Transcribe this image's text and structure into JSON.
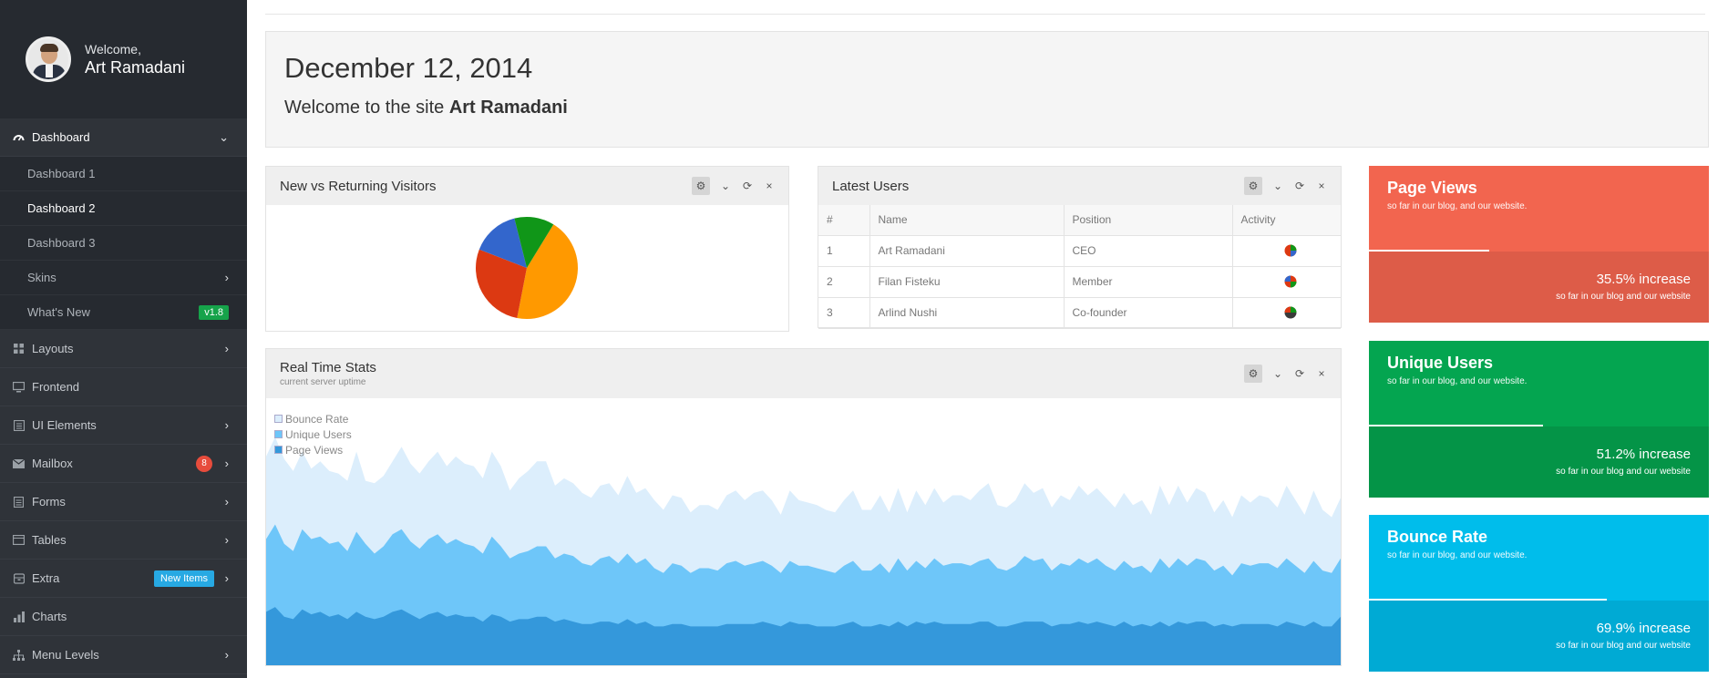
{
  "profile": {
    "welcome": "Welcome,",
    "name": "Art Ramadani"
  },
  "nav": {
    "dashboard": "Dashboard",
    "sub": [
      "Dashboard 1",
      "Dashboard 2",
      "Dashboard 3",
      "Skins",
      "What's New"
    ],
    "whats_new_badge": "v1.8",
    "layouts": "Layouts",
    "frontend": "Frontend",
    "ui_elements": "UI Elements",
    "mailbox": "Mailbox",
    "mailbox_count": "8",
    "forms": "Forms",
    "tables": "Tables",
    "extra": "Extra",
    "extra_badge": "New Items",
    "charts": "Charts",
    "menu_levels": "Menu Levels"
  },
  "hero": {
    "date": "December 12, 2014",
    "welcome_prefix": "Welcome to the site ",
    "welcome_name": "Art Ramadani"
  },
  "visitors": {
    "title": "New vs Returning Visitors",
    "chart_data": {
      "type": "pie",
      "values": [
        35,
        22,
        12,
        10
      ],
      "colors": [
        "#ff9900",
        "#dc3912",
        "#3366cc",
        "#109618"
      ]
    }
  },
  "latest_users": {
    "title": "Latest Users",
    "headers": [
      "#",
      "Name",
      "Position",
      "Activity"
    ],
    "rows": [
      {
        "num": "1",
        "name": "Art Ramadani",
        "position": "CEO"
      },
      {
        "num": "2",
        "name": "Filan Fisteku",
        "position": "Member"
      },
      {
        "num": "3",
        "name": "Arlind Nushi",
        "position": "Co-founder"
      }
    ]
  },
  "realtime": {
    "title": "Real Time Stats",
    "subtitle": "current server uptime",
    "chart_data": {
      "type": "area",
      "series": [
        {
          "name": "Bounce Rate",
          "color": "#dceefc",
          "values": [
            86,
            94,
            85,
            80,
            88,
            81,
            84,
            80,
            79,
            76,
            88,
            76,
            75,
            78,
            84,
            90,
            83,
            79,
            84,
            88,
            82,
            86,
            83,
            82,
            77,
            88,
            82,
            72,
            77,
            80,
            84,
            84,
            74,
            77,
            75,
            71,
            69,
            74,
            75,
            70,
            78,
            71,
            73,
            68,
            64,
            70,
            69,
            63,
            66,
            66,
            64,
            70,
            72,
            68,
            71,
            72,
            68,
            62,
            72,
            68,
            67,
            66,
            64,
            63,
            68,
            72,
            64,
            64,
            70,
            63,
            73,
            63,
            72,
            66,
            73,
            67,
            70,
            70,
            68,
            72,
            75,
            66,
            65,
            68,
            75,
            71,
            73,
            65,
            70,
            68,
            74,
            70,
            73,
            69,
            65,
            71,
            66,
            68,
            62,
            74,
            66,
            74,
            67,
            73,
            71,
            63,
            68,
            61,
            70,
            67,
            70,
            69,
            65,
            74,
            68,
            62,
            72,
            64,
            61,
            69
          ]
        },
        {
          "name": "Unique Users",
          "color": "#6ec6f9",
          "values": [
            52,
            58,
            50,
            47,
            56,
            52,
            53,
            50,
            51,
            47,
            55,
            50,
            46,
            49,
            54,
            56,
            51,
            48,
            52,
            54,
            50,
            52,
            50,
            49,
            46,
            53,
            49,
            44,
            46,
            47,
            49,
            49,
            44,
            46,
            45,
            42,
            41,
            44,
            45,
            42,
            46,
            42,
            44,
            40,
            38,
            42,
            41,
            38,
            40,
            40,
            39,
            42,
            43,
            41,
            42,
            43,
            41,
            38,
            43,
            41,
            41,
            40,
            39,
            38,
            41,
            43,
            39,
            39,
            42,
            38,
            44,
            39,
            43,
            40,
            44,
            41,
            42,
            42,
            41,
            43,
            44,
            40,
            39,
            41,
            45,
            43,
            44,
            39,
            42,
            41,
            44,
            42,
            44,
            41,
            39,
            43,
            40,
            41,
            38,
            44,
            40,
            44,
            41,
            44,
            43,
            39,
            41,
            37,
            42,
            41,
            42,
            42,
            40,
            44,
            41,
            38,
            43,
            39,
            38,
            44
          ]
        },
        {
          "name": "Page Views",
          "color": "#3498db",
          "values": [
            22,
            24,
            20,
            19,
            23,
            21,
            22,
            20,
            21,
            19,
            22,
            20,
            19,
            20,
            22,
            23,
            21,
            19,
            21,
            22,
            20,
            21,
            20,
            20,
            18,
            21,
            20,
            18,
            19,
            19,
            20,
            20,
            18,
            19,
            18,
            17,
            17,
            18,
            18,
            17,
            19,
            17,
            18,
            16,
            16,
            17,
            17,
            16,
            16,
            16,
            16,
            17,
            17,
            17,
            17,
            18,
            17,
            16,
            18,
            17,
            17,
            16,
            16,
            16,
            17,
            18,
            16,
            16,
            17,
            16,
            18,
            16,
            18,
            17,
            18,
            17,
            17,
            17,
            17,
            18,
            18,
            16,
            16,
            17,
            18,
            18,
            18,
            16,
            17,
            17,
            18,
            17,
            18,
            17,
            16,
            18,
            16,
            17,
            16,
            18,
            16,
            18,
            17,
            18,
            18,
            16,
            17,
            16,
            17,
            17,
            17,
            17,
            16,
            18,
            17,
            16,
            18,
            16,
            16,
            20
          ]
        }
      ]
    }
  },
  "stats": [
    {
      "title": "Page Views",
      "desc": "so far in our blog, and our website.",
      "increase": "35.5% increase",
      "desc2": "so far in our blog and our website",
      "fraction": 0.355,
      "top": "#f2654f",
      "bottom": "#dd5c48"
    },
    {
      "title": "Unique Users",
      "desc": "so far in our blog, and our website.",
      "increase": "51.2% increase",
      "desc2": "so far in our blog and our website",
      "fraction": 0.512,
      "top": "#04a550",
      "bottom": "#049447"
    },
    {
      "title": "Bounce Rate",
      "desc": "so far in our blog, and our website.",
      "increase": "69.9% increase",
      "desc2": "so far in our blog and our website",
      "fraction": 0.699,
      "top": "#00bdeb",
      "bottom": "#00aad4"
    }
  ]
}
